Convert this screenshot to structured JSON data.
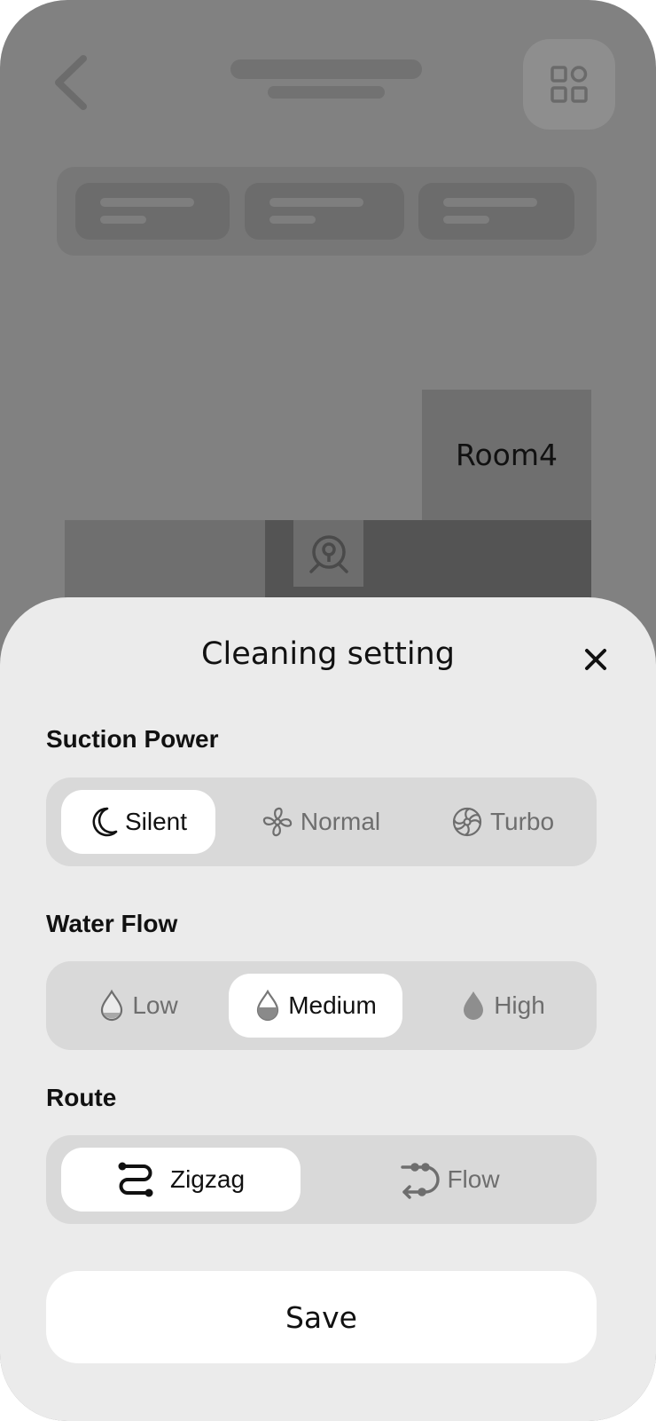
{
  "map": {
    "room_label": "Room4"
  },
  "sheet": {
    "title": "Cleaning setting",
    "sections": {
      "suction": {
        "label": "Suction Power",
        "options": [
          {
            "label": "Silent",
            "icon": "moon-icon",
            "selected": true
          },
          {
            "label": "Normal",
            "icon": "fan-icon",
            "selected": false
          },
          {
            "label": "Turbo",
            "icon": "turbo-fan-icon",
            "selected": false
          }
        ]
      },
      "water": {
        "label": "Water Flow",
        "options": [
          {
            "label": "Low",
            "icon": "drop-low-icon",
            "selected": false
          },
          {
            "label": "Medium",
            "icon": "drop-medium-icon",
            "selected": true
          },
          {
            "label": "High",
            "icon": "drop-high-icon",
            "selected": false
          }
        ]
      },
      "route": {
        "label": "Route",
        "options": [
          {
            "label": "Zigzag",
            "icon": "zigzag-route-icon",
            "selected": true
          },
          {
            "label": "Flow",
            "icon": "flow-route-icon",
            "selected": false
          }
        ]
      }
    },
    "save_label": "Save"
  },
  "colors": {
    "overlay_background": "#818181",
    "sheet_background": "#ebebeb",
    "segment_background": "#d9d9d9",
    "selected_option": "#ffffff",
    "text_primary": "#111111",
    "text_secondary": "#6e6e6e"
  }
}
